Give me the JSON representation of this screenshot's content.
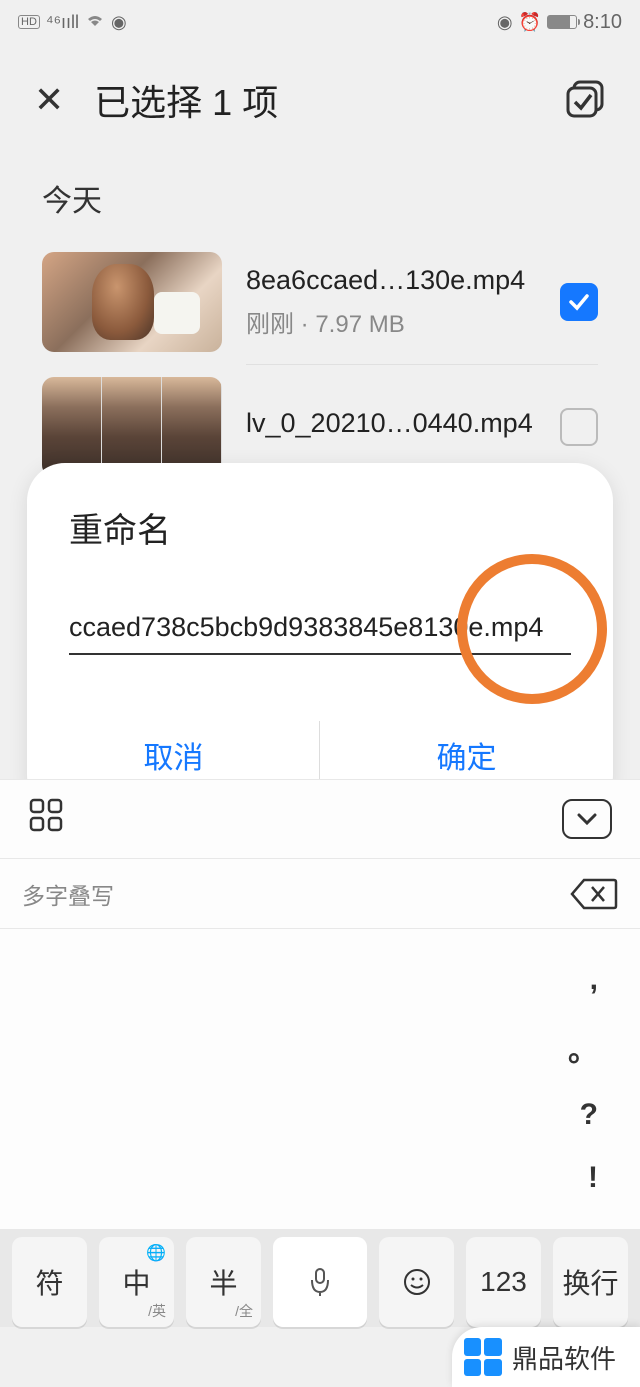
{
  "status": {
    "time": "8:10"
  },
  "header": {
    "title": "已选择 1 项"
  },
  "section": {
    "today": "今天"
  },
  "files": [
    {
      "name": "8ea6ccaed…130e.mp4",
      "meta": "刚刚 · 7.97 MB"
    },
    {
      "name": "lv_0_20210…0440.mp4",
      "meta": ""
    }
  ],
  "dialog": {
    "title": "重命名",
    "input": "ccaed738c5bcb9d9383845e8130e.mp4",
    "cancel": "取消",
    "confirm": "确定"
  },
  "keyboard": {
    "suggest": "多字叠写",
    "punct": [
      ",",
      "。",
      "?",
      "!"
    ],
    "sym": "符",
    "zh": "中",
    "zh_sub": "/英",
    "half": "半",
    "half_sub": "/全",
    "num": "123",
    "enter": "换行"
  },
  "watermark": "鼎品软件"
}
